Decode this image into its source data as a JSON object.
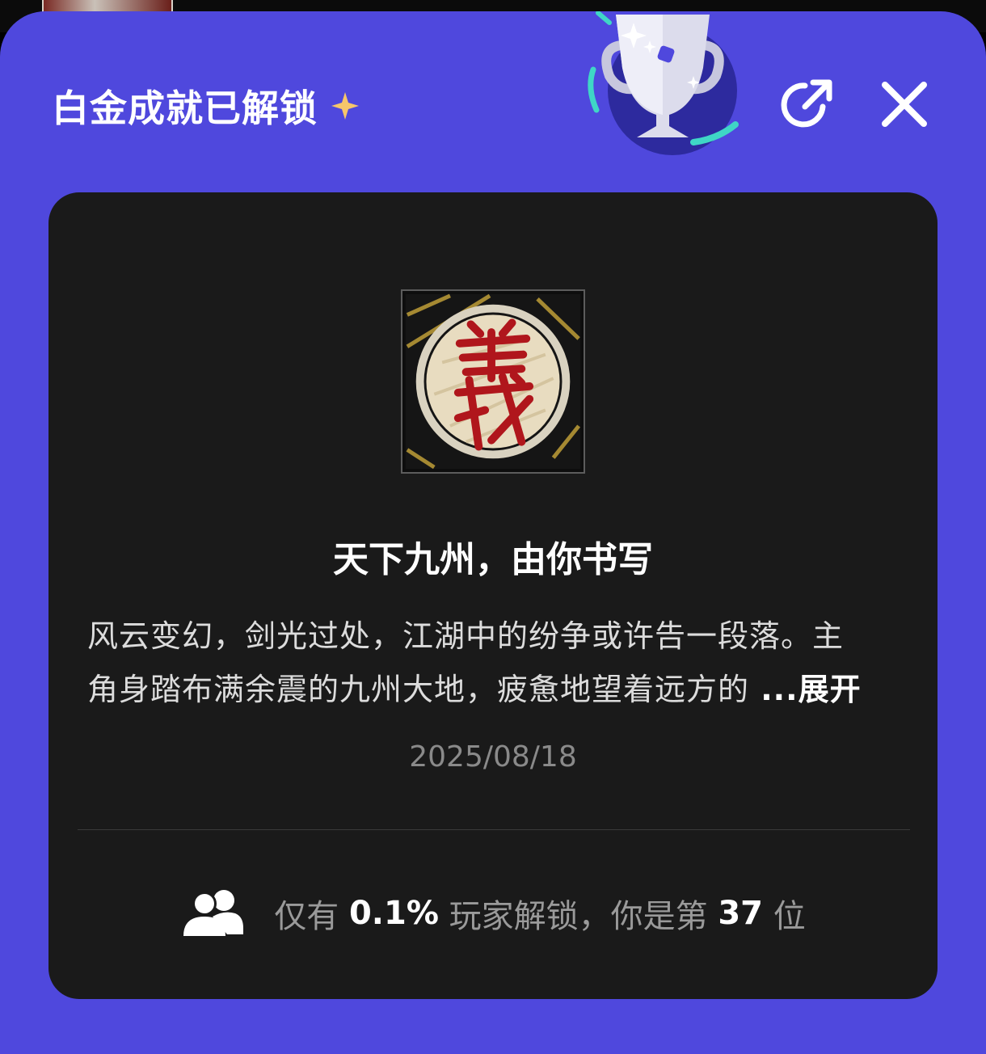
{
  "header": {
    "title": "白金成就已解锁"
  },
  "achievement": {
    "title": "天下九州，由你书写",
    "description_line1": "风云变幻，剑光过处，江湖中的纷争或许告一段落。主",
    "description_line2": "角身踏布满余震的九州大地，疲惫地望着远方的",
    "ellipsis": " ...",
    "expand_label": "展开",
    "date": "2025/08/18"
  },
  "stats": {
    "prefix": "仅有 ",
    "percent": "0.1%",
    "middle": " 玩家解锁，你是第 ",
    "rank": "37",
    "suffix": " 位"
  },
  "colors": {
    "sheet": "#4f48dd",
    "card": "#1a1a1a",
    "accent_teal": "#3fd6c6",
    "badge_red": "#b0161c"
  }
}
